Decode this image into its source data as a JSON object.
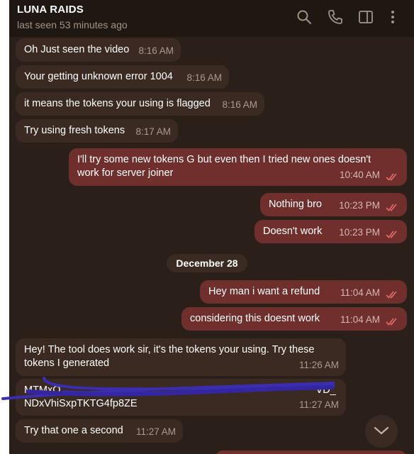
{
  "header": {
    "title": "LUNA RAIDS",
    "status": "last seen 53 minutes ago"
  },
  "messages": [
    {
      "text": "Oh Just seen the video",
      "time": "8:16 AM"
    },
    {
      "text": "Your getting unknown error 1004",
      "time": "8:16 AM"
    },
    {
      "text": "it means the tokens your using is flagged",
      "time": "8:16 AM"
    },
    {
      "text": "Try using fresh tokens",
      "time": "8:17 AM"
    },
    {
      "text": "I'll try some new tokens G but even then I tried new ones doesn't work for server joiner",
      "time": "10:40 AM"
    },
    {
      "text": "Nothing bro",
      "time": "10:23 PM"
    },
    {
      "text": "Doesn't work",
      "time": "10:23 PM"
    },
    {
      "text": "Hey man i want a refund",
      "time": "11:04 AM"
    },
    {
      "text": "considering this doesnt work",
      "time": "11:04 AM"
    },
    {
      "text": "Hey! The tool does work sir, it's the tokens your using. Try these tokens I generated",
      "time": "11:26 AM"
    },
    {
      "line1": "MTMxO",
      "line2": "NDxVhiSxpTKTG4fp8ZE",
      "tail": "VD_",
      "time": "11:27 AM"
    },
    {
      "text": "Try that one a second",
      "time": "11:27 AM"
    }
  ],
  "date_divider": "December 28",
  "icons": [
    "search-icon",
    "phone-icon",
    "sidebar-toggle-icon",
    "more-vertical-icon",
    "read-double-check-icon",
    "chevron-down-icon"
  ],
  "colors": {
    "background": "#2a2019",
    "header": "#1f1712",
    "incoming_bubble": "#3a2a22",
    "outgoing_bubble": "#6f2f2c",
    "scribble": "#3b2db0"
  }
}
